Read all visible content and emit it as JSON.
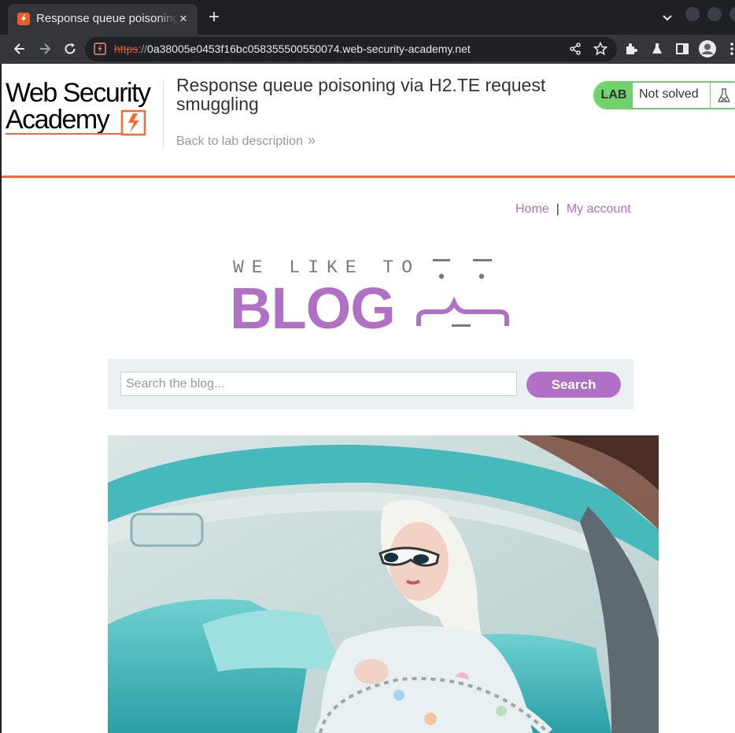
{
  "browser": {
    "tab_title": "Response queue poisoning via H2.TE request smuggling",
    "tab_close": "×",
    "new_tab": "+",
    "url_scheme": "https",
    "url_sep": "://",
    "url_host": "0a38005e0453f16bc058355500550074.web-security-academy.net"
  },
  "lab": {
    "logo_alt": "Web Security Academy",
    "title": "Response queue poisoning via H2.TE request smuggling",
    "back_link": "Back to lab description",
    "back_chevron": "»",
    "badge": "LAB",
    "status": "Not solved",
    "colors": {
      "accent": "#ff6633",
      "lab_green": "#70d16d"
    }
  },
  "blog": {
    "nav": {
      "home": "Home",
      "separator": "|",
      "account": "My account"
    },
    "banner_top": "WE LIKE TO",
    "banner_main": "BLOG",
    "search": {
      "placeholder": "Search the blog...",
      "value": "",
      "button": "Search"
    },
    "colors": {
      "brand": "#b070c6",
      "panel": "#ebf0f2"
    }
  }
}
